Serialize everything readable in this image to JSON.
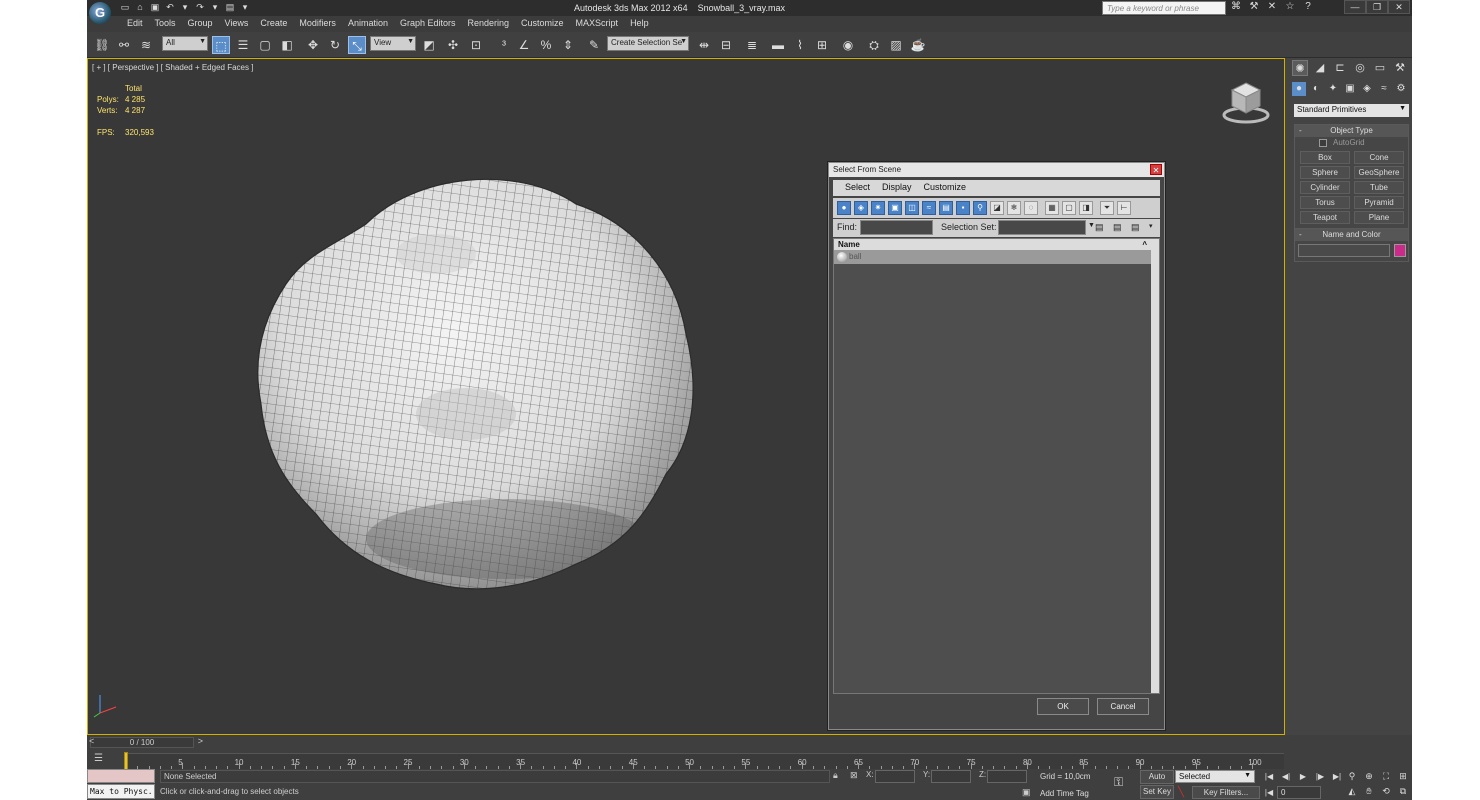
{
  "title_bar": {
    "app_name": "Autodesk 3ds Max  2012 x64",
    "file_name": "Snowball_3_vray.max",
    "search_placeholder": "Type a keyword or phrase"
  },
  "menu": [
    "Edit",
    "Tools",
    "Group",
    "Views",
    "Create",
    "Modifiers",
    "Animation",
    "Graph Editors",
    "Rendering",
    "Customize",
    "MAXScript",
    "Help"
  ],
  "toolbar": {
    "filter_value": "All",
    "refcoord_value": "View",
    "selection_set_value": "Create Selection Se"
  },
  "viewport": {
    "label": "[ + ] [ Perspective ] [ Shaded + Edged Faces ]",
    "stats": {
      "total_header": "Total",
      "polys_label": "Polys:",
      "polys_value": "4 285",
      "verts_label": "Verts:",
      "verts_value": "4 287",
      "fps_label": "FPS:",
      "fps_value": "320,593"
    }
  },
  "dialog": {
    "title": "Select From Scene",
    "menu": [
      "Select",
      "Display",
      "Customize"
    ],
    "find_label": "Find:",
    "selection_set_label": "Selection Set:",
    "column_name": "Name",
    "items": [
      {
        "name": "ball"
      }
    ],
    "ok_label": "OK",
    "cancel_label": "Cancel"
  },
  "command_panel": {
    "category": "Standard Primitives",
    "object_type_title": "Object Type",
    "autogrid_label": "AutoGrid",
    "primitives": [
      "Box",
      "Cone",
      "Sphere",
      "GeoSphere",
      "Cylinder",
      "Tube",
      "Torus",
      "Pyramid",
      "Teapot",
      "Plane"
    ],
    "name_color_title": "Name and Color",
    "object_color": "#cc2a8a"
  },
  "timeline": {
    "frame_counter": "0 / 100",
    "ticks": [
      "5",
      "10",
      "15",
      "20",
      "25",
      "30",
      "35",
      "40",
      "45",
      "50",
      "55",
      "60",
      "65",
      "70",
      "75",
      "80",
      "85",
      "90",
      "95",
      "100"
    ]
  },
  "status": {
    "script_listener": "Max to Physc.",
    "selection_status": "None Selected",
    "prompt": "Click or click-and-drag to select objects",
    "x_label": "X:",
    "y_label": "Y:",
    "z_label": "Z:",
    "grid": "Grid = 10,0cm",
    "add_time_tag": "Add Time Tag",
    "auto_key": "Auto Key",
    "set_key": "Set Key",
    "key_mode_value": "Selected",
    "key_filters": "Key Filters...",
    "current_frame": "0"
  }
}
